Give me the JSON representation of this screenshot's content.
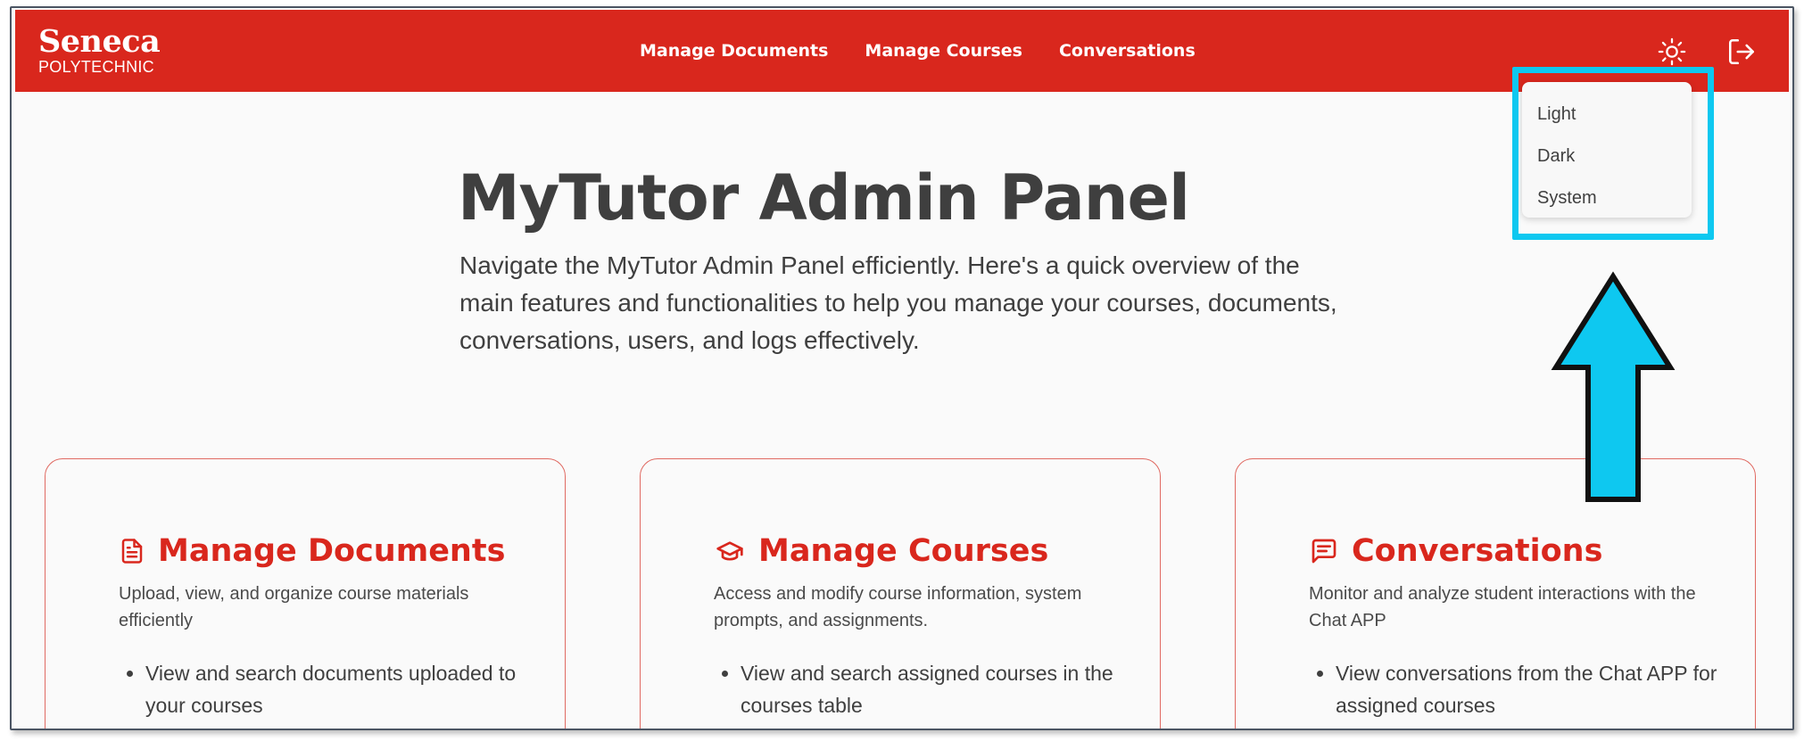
{
  "brand": {
    "name": "Seneca",
    "tagline": "POLYTECHNIC"
  },
  "nav": {
    "links": [
      "Manage Documents",
      "Manage Courses",
      "Conversations"
    ]
  },
  "icons": {
    "theme": "sun-icon",
    "logout": "logout-icon",
    "documents": "document-icon",
    "courses": "graduation-cap-icon",
    "conversations": "chat-icon"
  },
  "theme_menu": {
    "items": [
      "Light",
      "Dark",
      "System"
    ]
  },
  "hero": {
    "title": "MyTutor Admin Panel",
    "description": "Navigate the MyTutor Admin Panel efficiently. Here's a quick overview of the main features and functionalities to help you manage your courses, documents, conversations, users, and logs effectively."
  },
  "cards": [
    {
      "title": "Manage Documents",
      "description": "Upload, view, and organize course materials efficiently",
      "bullet": "View and search documents uploaded to your courses"
    },
    {
      "title": "Manage Courses",
      "description": "Access and modify course information, system prompts, and assignments.",
      "bullet": "View and search assigned courses in the courses table"
    },
    {
      "title": "Conversations",
      "description": "Monitor and analyze student interactions with the Chat APP",
      "bullet": "View conversations from the Chat APP for assigned courses"
    }
  ],
  "colors": {
    "brand_red": "#d9271d",
    "highlight_cyan": "#0ec8f0",
    "text_dark": "#3f3f3f"
  }
}
